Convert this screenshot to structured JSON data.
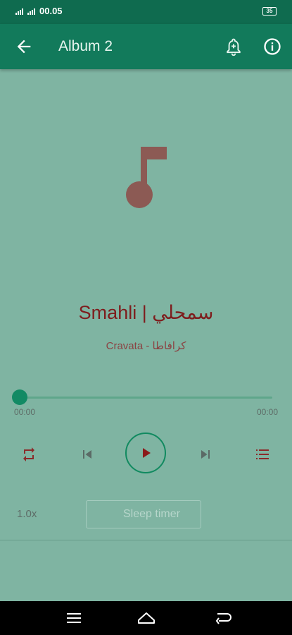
{
  "status_bar": {
    "time": "00.05",
    "battery": "35"
  },
  "app_bar": {
    "title": "Album 2",
    "back_icon": "arrow-left",
    "alarm_icon": "bell-add",
    "info_icon": "info-circle"
  },
  "now_playing": {
    "art_icon": "music-note",
    "song_title": "Smahli | سمحلي",
    "artist": "Cravata - كرافاطا"
  },
  "progress": {
    "elapsed": "00:00",
    "duration": "00:00",
    "fraction": 0
  },
  "controls": {
    "repeat_icon": "repeat",
    "previous_icon": "skip-previous",
    "play_icon": "play",
    "next_icon": "skip-next",
    "playlist_icon": "queue-list"
  },
  "extras": {
    "speed": "1.0x",
    "sleep_timer_label": "Sleep timer",
    "sleep_icon": "moon"
  },
  "nav_bar": {
    "menu_icon": "menu",
    "home_icon": "home",
    "back_icon": "return"
  },
  "colors": {
    "primary_dark": "#0f6b4f",
    "primary": "#127a5b",
    "background": "#7fb4a2",
    "accent": "#7e1d1d"
  }
}
